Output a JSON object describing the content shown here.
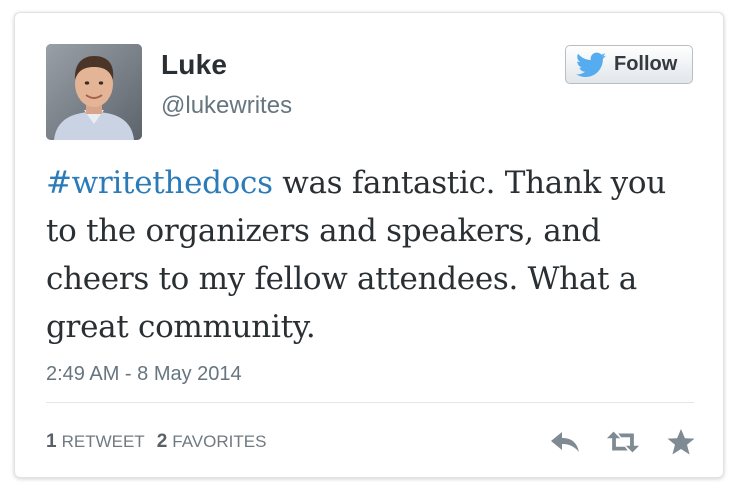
{
  "user": {
    "name": "Luke",
    "handle": "@lukewrites"
  },
  "follow_button": {
    "label": "Follow"
  },
  "tweet": {
    "hashtag": "#writethedocs",
    "text": " was fantastic. Thank you to the organizers and speakers, and cheers to my fellow attendees. What a great community.",
    "timestamp": "2:49 AM - 8 May 2014"
  },
  "stats": {
    "retweets_count": "1",
    "retweets_label": "RETWEET",
    "favorites_count": "2",
    "favorites_label": "FAVORITES"
  },
  "colors": {
    "hashtag": "#2b7bb9",
    "twitter_blue": "#55acee",
    "icon_gray": "#7f8a93"
  },
  "icons": [
    "twitter-bird-icon",
    "reply-icon",
    "retweet-icon",
    "favorite-star-icon"
  ]
}
